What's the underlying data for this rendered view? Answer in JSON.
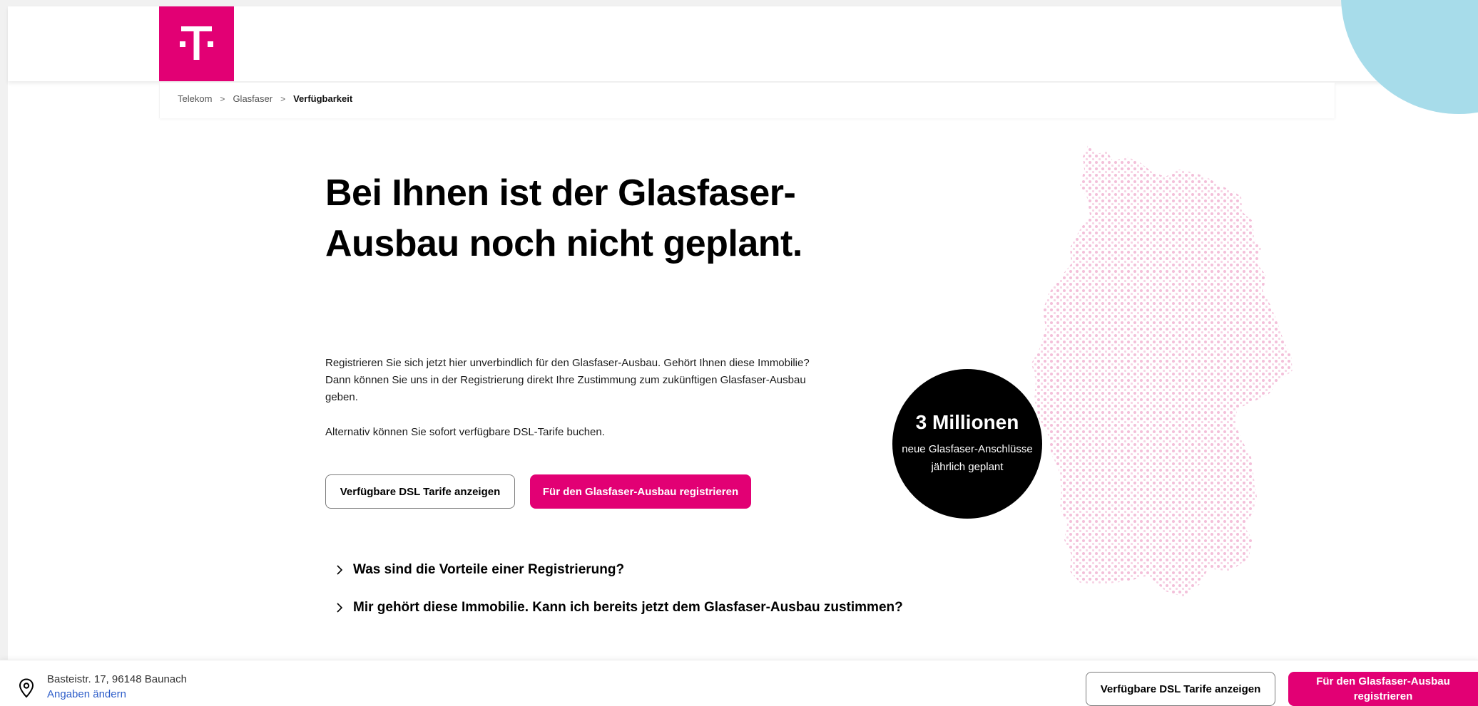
{
  "brand": {
    "logo_letter": "T",
    "accent_color": "#e20074",
    "secondary_color": "#a7dcea"
  },
  "breadcrumb": {
    "items": [
      "Telekom",
      "Glasfaser",
      "Verfügbarkeit"
    ],
    "separator": ">"
  },
  "hero": {
    "headline": "Bei Ihnen ist der Glasfaser-Ausbau noch nicht geplant.",
    "paragraph1": "Registrieren Sie sich jetzt hier unverbindlich für den Glasfaser-Ausbau. Gehört Ihnen diese Immobilie? Dann können Sie uns in der Registrierung direkt Ihre Zustimmung zum zukünftigen Glasfaser-Ausbau geben.",
    "paragraph2": "Alternativ können Sie sofort verfügbare DSL-Tarife buchen.",
    "btn_dsl": "Verfügbare DSL Tarife anzeigen",
    "btn_register": "Für den Glasfaser-Ausbau registrieren"
  },
  "faq": [
    {
      "question": "Was sind die Vorteile einer Registrierung?",
      "icon": "chevron-right-icon"
    },
    {
      "question": "Mir gehört diese Immobilie. Kann ich bereits jetzt dem Glasfaser-Ausbau zustimmen?",
      "icon": "chevron-right-icon"
    }
  ],
  "stat": {
    "number": "3 Millionen",
    "caption": "neue Glasfaser-Anschlüsse jährlich geplant"
  },
  "footer": {
    "address": "Basteistr. 17, 96148 Baunach",
    "change_link": "Angaben ändern",
    "btn_dsl": "Verfügbare DSL Tarife anzeigen",
    "btn_register": "Für den Glasfaser-Ausbau registrieren"
  }
}
